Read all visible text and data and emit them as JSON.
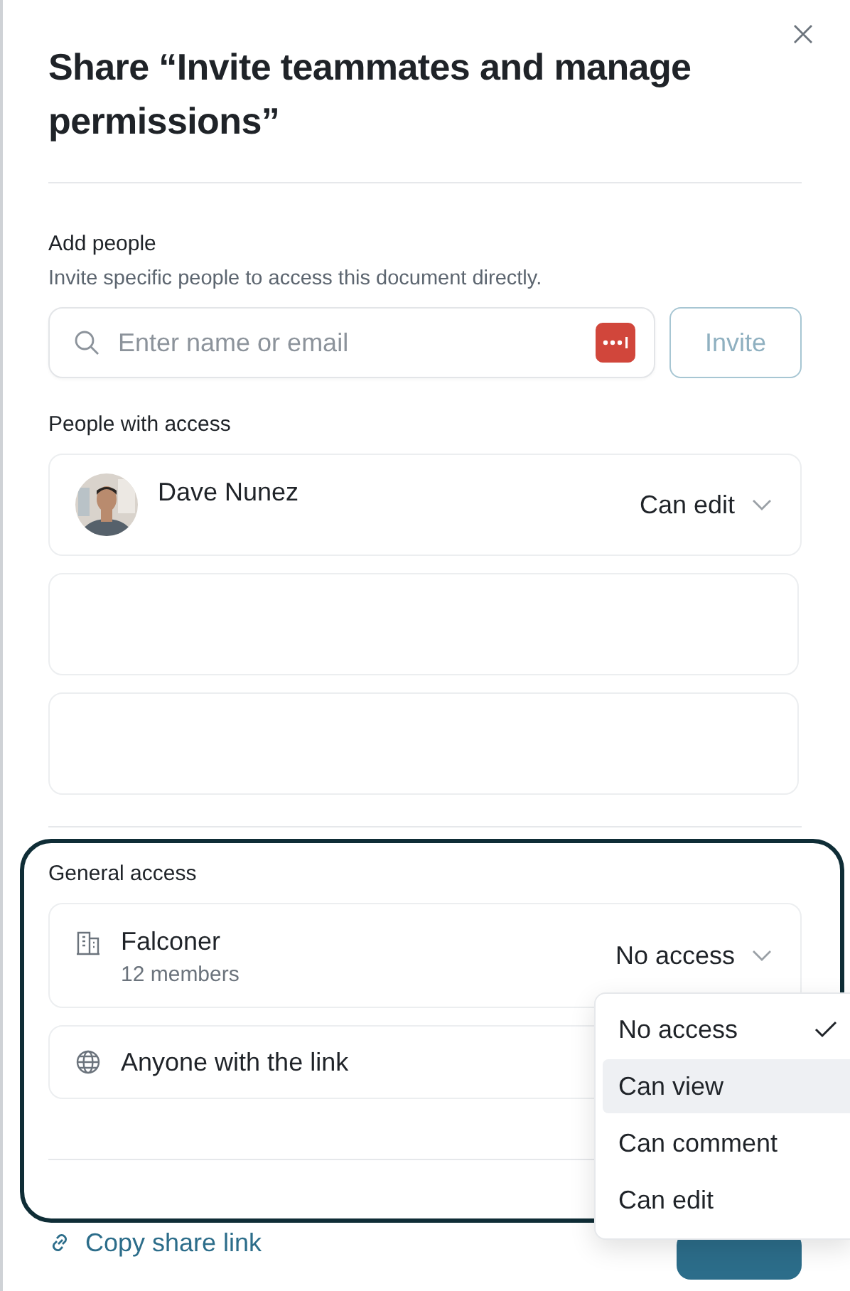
{
  "dialog": {
    "title": "Share “Invite teammates and manage permissions”"
  },
  "add_people": {
    "heading": "Add people",
    "description": "Invite specific people to access this document directly.",
    "search": {
      "placeholder": "Enter name or email"
    },
    "invite_button": {
      "label": "Invite",
      "disabled": true
    }
  },
  "people_with_access": {
    "heading": "People with access",
    "rows": [
      {
        "kind": "person",
        "name": "Dave Nunez",
        "role": "Can edit"
      },
      {
        "kind": "blank"
      },
      {
        "kind": "blank"
      }
    ]
  },
  "general_access": {
    "heading": "General access",
    "highlighted": true,
    "rows": [
      {
        "kind": "organization",
        "name": "Falconer",
        "detail": "12 members",
        "role": "No access"
      },
      {
        "kind": "link",
        "name": "Anyone with the link"
      }
    ],
    "menu": {
      "items": [
        {
          "label": "No access",
          "selected": true,
          "hovered": false
        },
        {
          "label": "Can view",
          "selected": false,
          "hovered": true
        },
        {
          "label": "Can comment",
          "selected": false,
          "hovered": false
        },
        {
          "label": "Can edit",
          "selected": false,
          "hovered": false
        }
      ]
    }
  },
  "footer": {
    "copy_link": "Copy share link"
  }
}
